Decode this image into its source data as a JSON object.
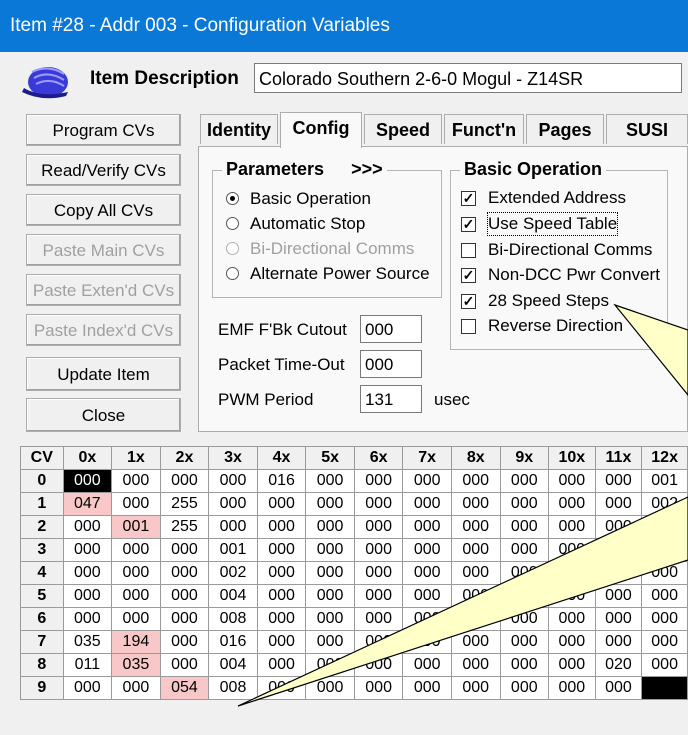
{
  "window": {
    "title": "Item #28 - Addr 003 - Configuration Variables"
  },
  "description": {
    "label": "Item Description",
    "value": "Colorado Southern 2-6-0 Mogul - Z14SR"
  },
  "buttons": {
    "program": "Program CVs",
    "read_verify": "Read/Verify CVs",
    "copy_all": "Copy All CVs",
    "paste_main": "Paste Main CVs",
    "paste_extended": "Paste Exten'd CVs",
    "paste_indexed": "Paste Index'd CVs",
    "update": "Update Item",
    "close": "Close"
  },
  "tabs": [
    "Identity",
    "Config",
    "Speed",
    "Funct'n",
    "Pages",
    "SUSI"
  ],
  "parameters": {
    "title": "Parameters",
    "more": ">>>",
    "options": [
      "Basic Operation",
      "Automatic Stop",
      "Bi-Directional Comms",
      "Alternate Power Source"
    ],
    "selected": 0
  },
  "basic_operation": {
    "title": "Basic Operation",
    "options": [
      {
        "label": "Extended Address",
        "checked": true
      },
      {
        "label": "Use Speed Table",
        "checked": true
      },
      {
        "label": "Bi-Directional Comms",
        "checked": false
      },
      {
        "label": "Non-DCC Pwr Convert",
        "checked": true
      },
      {
        "label": "28 Speed Steps",
        "checked": true
      },
      {
        "label": "Reverse Direction",
        "checked": false
      }
    ]
  },
  "fields": {
    "emf_label": "EMF F'Bk Cutout",
    "emf_value": "000",
    "packet_label": "Packet Time-Out",
    "packet_value": "000",
    "pwm_label": "PWM Period",
    "pwm_value": "131",
    "pwm_unit": "usec"
  },
  "cv_grid": {
    "corner": "CV",
    "columns": [
      "0x",
      "1x",
      "2x",
      "3x",
      "4x",
      "5x",
      "6x",
      "7x",
      "8x",
      "9x",
      "10x",
      "11x",
      "12x"
    ],
    "rows": [
      {
        "label": "0",
        "cells": [
          "000",
          "000",
          "000",
          "000",
          "016",
          "000",
          "000",
          "000",
          "000",
          "000",
          "000",
          "000",
          "001"
        ]
      },
      {
        "label": "1",
        "cells": [
          "047",
          "000",
          "255",
          "000",
          "000",
          "000",
          "000",
          "000",
          "000",
          "000",
          "000",
          "000",
          "002"
        ]
      },
      {
        "label": "2",
        "cells": [
          "000",
          "001",
          "255",
          "000",
          "000",
          "000",
          "000",
          "000",
          "000",
          "000",
          "000",
          "000",
          "000"
        ]
      },
      {
        "label": "3",
        "cells": [
          "000",
          "000",
          "000",
          "001",
          "000",
          "000",
          "000",
          "000",
          "000",
          "000",
          "000",
          "000",
          "000"
        ]
      },
      {
        "label": "4",
        "cells": [
          "000",
          "000",
          "000",
          "002",
          "000",
          "000",
          "000",
          "000",
          "000",
          "000",
          "000",
          "000",
          "000"
        ]
      },
      {
        "label": "5",
        "cells": [
          "000",
          "000",
          "000",
          "004",
          "000",
          "000",
          "000",
          "000",
          "000",
          "000",
          "000",
          "000",
          "000"
        ]
      },
      {
        "label": "6",
        "cells": [
          "000",
          "000",
          "000",
          "008",
          "000",
          "000",
          "000",
          "000",
          "000",
          "000",
          "000",
          "000",
          "000"
        ]
      },
      {
        "label": "7",
        "cells": [
          "035",
          "194",
          "000",
          "016",
          "000",
          "000",
          "000",
          "000",
          "000",
          "000",
          "000",
          "000",
          "000"
        ]
      },
      {
        "label": "8",
        "cells": [
          "011",
          "035",
          "000",
          "004",
          "000",
          "000",
          "000",
          "000",
          "000",
          "000",
          "000",
          "020",
          "000"
        ]
      },
      {
        "label": "9",
        "cells": [
          "000",
          "000",
          "054",
          "008",
          "000",
          "000",
          "000",
          "000",
          "000",
          "000",
          "000",
          "000",
          ""
        ]
      }
    ],
    "highlight_color": "#f8c7c7",
    "selected_color": "#000000"
  }
}
